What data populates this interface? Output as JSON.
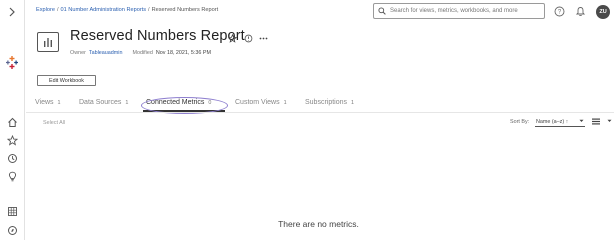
{
  "breadcrumb": {
    "items": [
      "Explore",
      "01 Number Administration Reports"
    ],
    "current": "Reserved Numbers Report",
    "separator": "/"
  },
  "search": {
    "placeholder": "Search for views, metrics, workbooks, and more"
  },
  "user": {
    "initials": "ZU"
  },
  "header": {
    "title": "Reserved Numbers Report",
    "owner_label": "Owner",
    "owner_value": "Tableauadmin",
    "modified_label": "Modified",
    "modified_value": "Nov 18, 2021, 5:36 PM"
  },
  "edit_workbook_label": "Edit Workbook",
  "tabs": [
    {
      "label": "Views",
      "count": "1"
    },
    {
      "label": "Data Sources",
      "count": "1"
    },
    {
      "label": "Connected Metrics",
      "count": "0"
    },
    {
      "label": "Custom Views",
      "count": "1"
    },
    {
      "label": "Subscriptions",
      "count": "1"
    }
  ],
  "toolbar": {
    "select_all": "Select All",
    "sort_by_label": "Sort By:",
    "sort_value": "Name (a–z) ↑"
  },
  "empty_message": "There are no metrics.",
  "colors": {
    "link": "#2a5fb0",
    "highlight_oval": "#8e7fcf",
    "avatar": "#4a4a4a"
  }
}
